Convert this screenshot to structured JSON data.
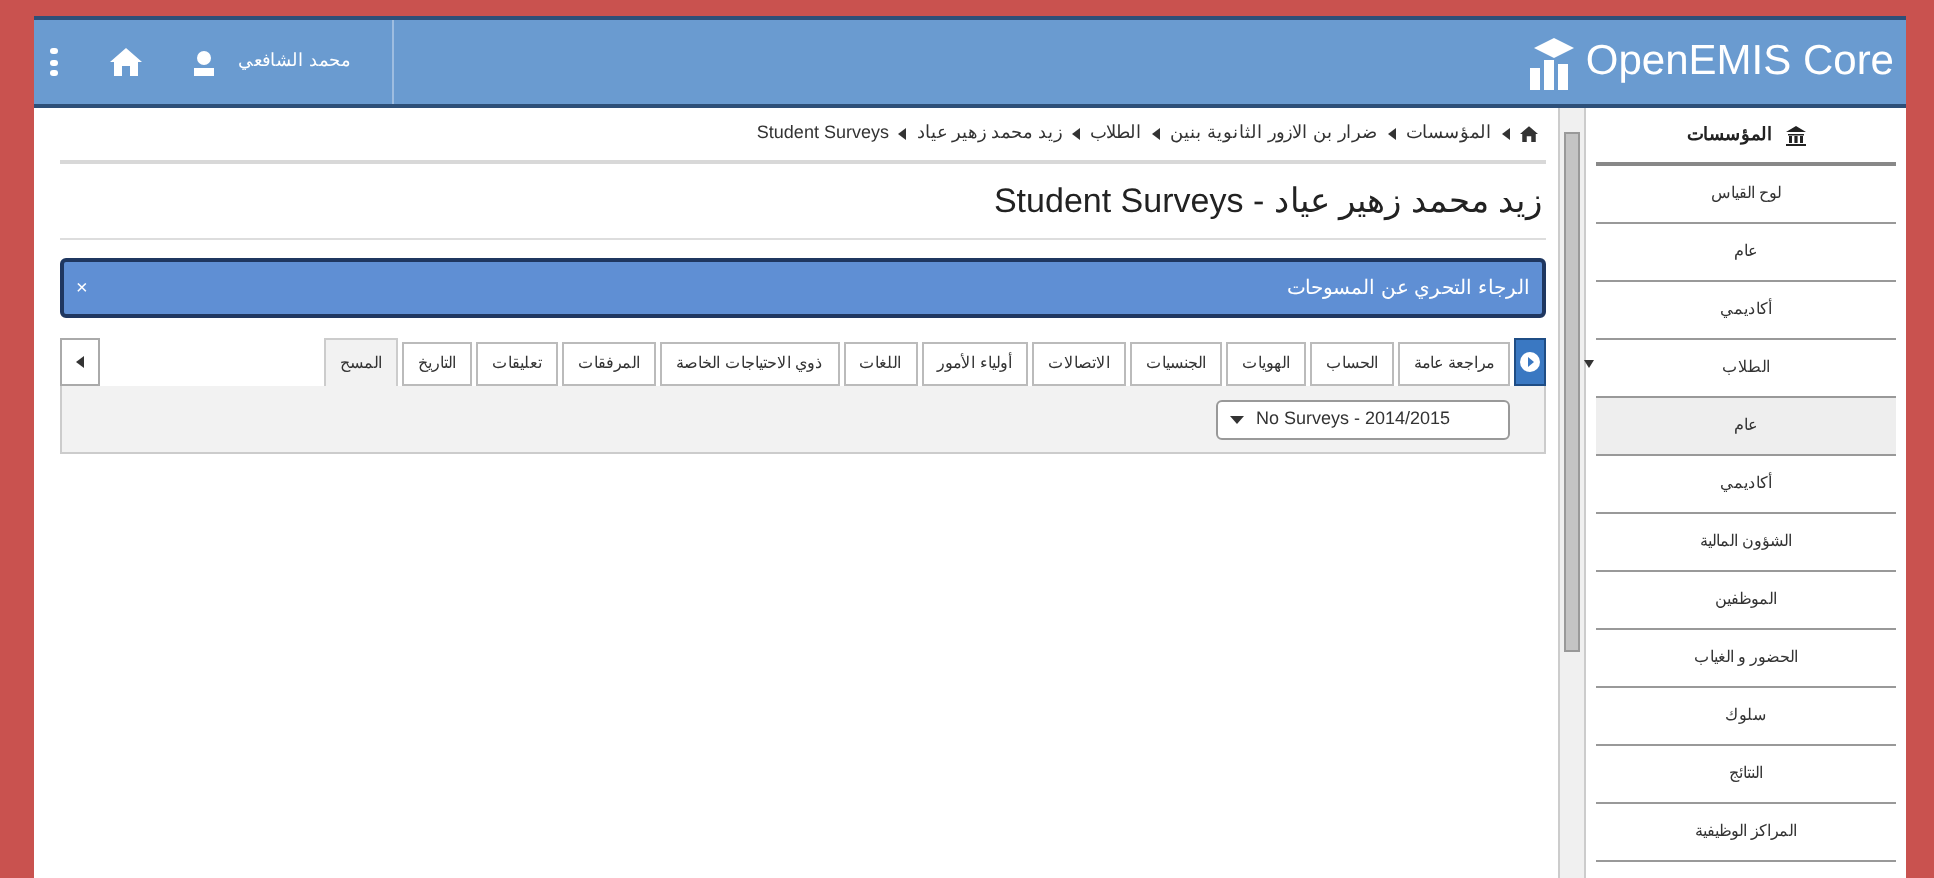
{
  "header": {
    "user_name": "محمد الشافعي",
    "logo_text": "OpenEMIS Core"
  },
  "breadcrumb": [
    "المؤسسات",
    "ضرار بن الازور الثانوية بنين",
    "الطلاب",
    "زيد محمد زهير عياد",
    "Student Surveys"
  ],
  "page_title": "زيد محمد زهير عياد - Student Surveys",
  "alert": {
    "message": "الرجاء التحري عن المسوحات",
    "dismiss": "×"
  },
  "tabs": [
    {
      "label": "مراجعة عامة",
      "selected": false
    },
    {
      "label": "الحساب",
      "selected": false
    },
    {
      "label": "الهويات",
      "selected": false
    },
    {
      "label": "الجنسيات",
      "selected": false
    },
    {
      "label": "الاتصالات",
      "selected": false
    },
    {
      "label": "أولياء الأمور",
      "selected": false
    },
    {
      "label": "اللغات",
      "selected": false
    },
    {
      "label": "ذوي الاحتياجات الخاصة",
      "selected": false
    },
    {
      "label": "المرفقات",
      "selected": false
    },
    {
      "label": "تعليقات",
      "selected": false
    },
    {
      "label": "التاريخ",
      "selected": false
    },
    {
      "label": "المسح",
      "selected": true
    }
  ],
  "survey_select": {
    "value": "No Surveys - 2014/2015"
  },
  "sidebar": {
    "heading": "المؤسسات",
    "items": [
      {
        "label": "لوح القياس",
        "selected": false
      },
      {
        "label": "عام",
        "selected": false
      },
      {
        "label": "أكاديمي",
        "selected": false
      },
      {
        "label": "الطلاب",
        "selected": false,
        "expanded": true,
        "children": [
          {
            "label": "عام",
            "selected": true
          },
          {
            "label": "أكاديمي",
            "selected": false
          },
          {
            "label": "الشؤون المالية",
            "selected": false
          },
          {
            "label": "الموظفين",
            "selected": false
          },
          {
            "label": "الحضور و الغياب",
            "selected": false
          },
          {
            "label": "سلوك",
            "selected": false
          },
          {
            "label": "النتائج",
            "selected": false
          },
          {
            "label": "المراكز الوظيفية",
            "selected": false
          }
        ]
      }
    ]
  }
}
